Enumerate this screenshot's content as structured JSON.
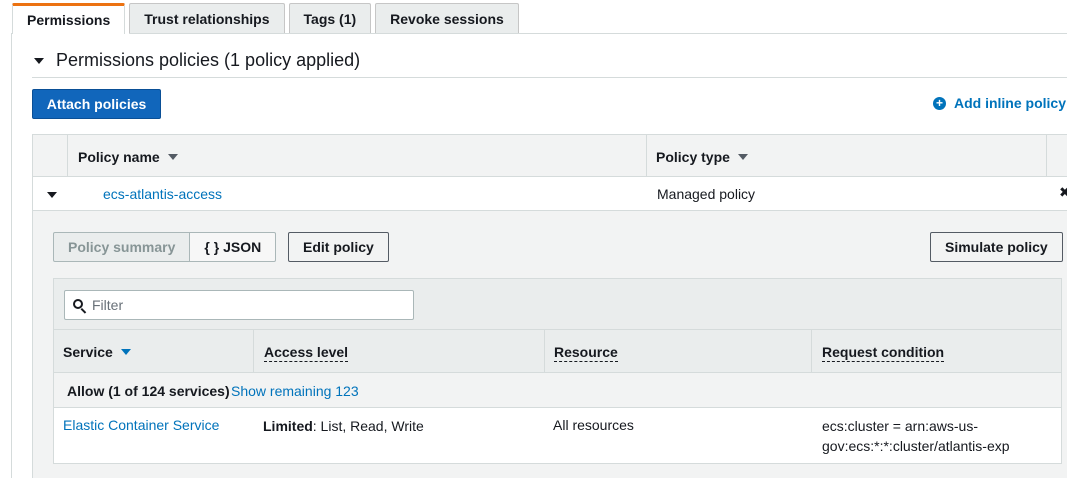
{
  "tabs": [
    {
      "label": "Permissions",
      "active": true
    },
    {
      "label": "Trust relationships",
      "active": false
    },
    {
      "label": "Tags (1)",
      "active": false
    },
    {
      "label": "Revoke sessions",
      "active": false
    }
  ],
  "section": {
    "title": "Permissions policies (1 policy applied)",
    "attach_label": "Attach policies",
    "add_inline_label": "Add inline policy"
  },
  "policies_table": {
    "headers": {
      "name": "Policy name",
      "type": "Policy type"
    },
    "rows": [
      {
        "name": "ecs-atlantis-access",
        "type": "Managed policy",
        "remove_glyph": "✖"
      }
    ]
  },
  "details": {
    "view_tabs": {
      "summary": "Policy summary",
      "json": "{ } JSON"
    },
    "edit_label": "Edit policy",
    "simulate_label": "Simulate policy",
    "filter_placeholder": "Filter",
    "headers": {
      "service": "Service",
      "access": "Access level",
      "resource": "Resource",
      "condition": "Request condition"
    },
    "allow_text": "Allow (1 of 124 services)",
    "show_remaining": "Show remaining 123",
    "services": [
      {
        "service": "Elastic Container Service",
        "access_level": "Limited",
        "access_actions": ": List, Read, Write",
        "resource": "All resources",
        "condition": "ecs:cluster = arn:aws-us-gov:ecs:*:*:cluster/atlantis-exp"
      }
    ]
  },
  "colors": {
    "accent_tab": "#ec7211",
    "primary_button": "#1166bb",
    "link": "#0073bb"
  },
  "icons": [
    "plus-circle-icon",
    "caret-down-icon",
    "sort-caret-icon",
    "search-icon",
    "close-icon"
  ]
}
